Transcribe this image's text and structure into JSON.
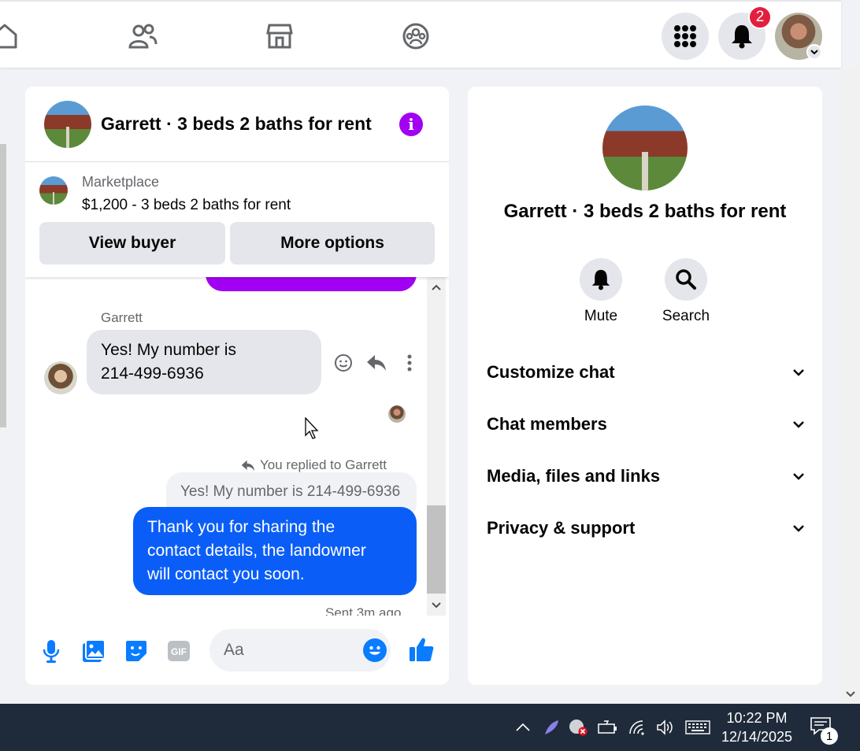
{
  "topnav": {
    "notifications_badge": "2"
  },
  "chat": {
    "title": "Garrett · 3 beds 2 baths for rent",
    "marketplace": {
      "label": "Marketplace",
      "listing": "$1,200 - 3 beds 2 baths for rent",
      "view_buyer": "View buyer",
      "more_options": "More options"
    },
    "messages": {
      "sender_name": "Garrett",
      "incoming_line1": "Yes! My number is",
      "incoming_line2": "214-499-6936",
      "replied_to": "You replied to Garrett",
      "quoted": "Yes! My number is 214-499-6936",
      "outgoing_line1": "Thank you for sharing the",
      "outgoing_line2": "contact details, the landowner",
      "outgoing_line3": "will contact you soon.",
      "sent_time": "Sent 3m ago"
    },
    "composer": {
      "placeholder": "Aa"
    }
  },
  "info_panel": {
    "title": "Garrett · 3 beds 2 baths for rent",
    "actions": [
      {
        "label": "Mute",
        "icon": "bell-icon"
      },
      {
        "label": "Search",
        "icon": "search-icon"
      }
    ],
    "sections": [
      {
        "label": "Customize chat"
      },
      {
        "label": "Chat members"
      },
      {
        "label": "Media, files and links"
      },
      {
        "label": "Privacy & support"
      }
    ]
  },
  "taskbar": {
    "time": "10:22 PM",
    "date": "12/14/2025",
    "notification_count": "1"
  },
  "colors": {
    "accent_purple": "#a100f2",
    "messenger_blue": "#0a5ef7",
    "badge_red": "#e41e3f"
  }
}
